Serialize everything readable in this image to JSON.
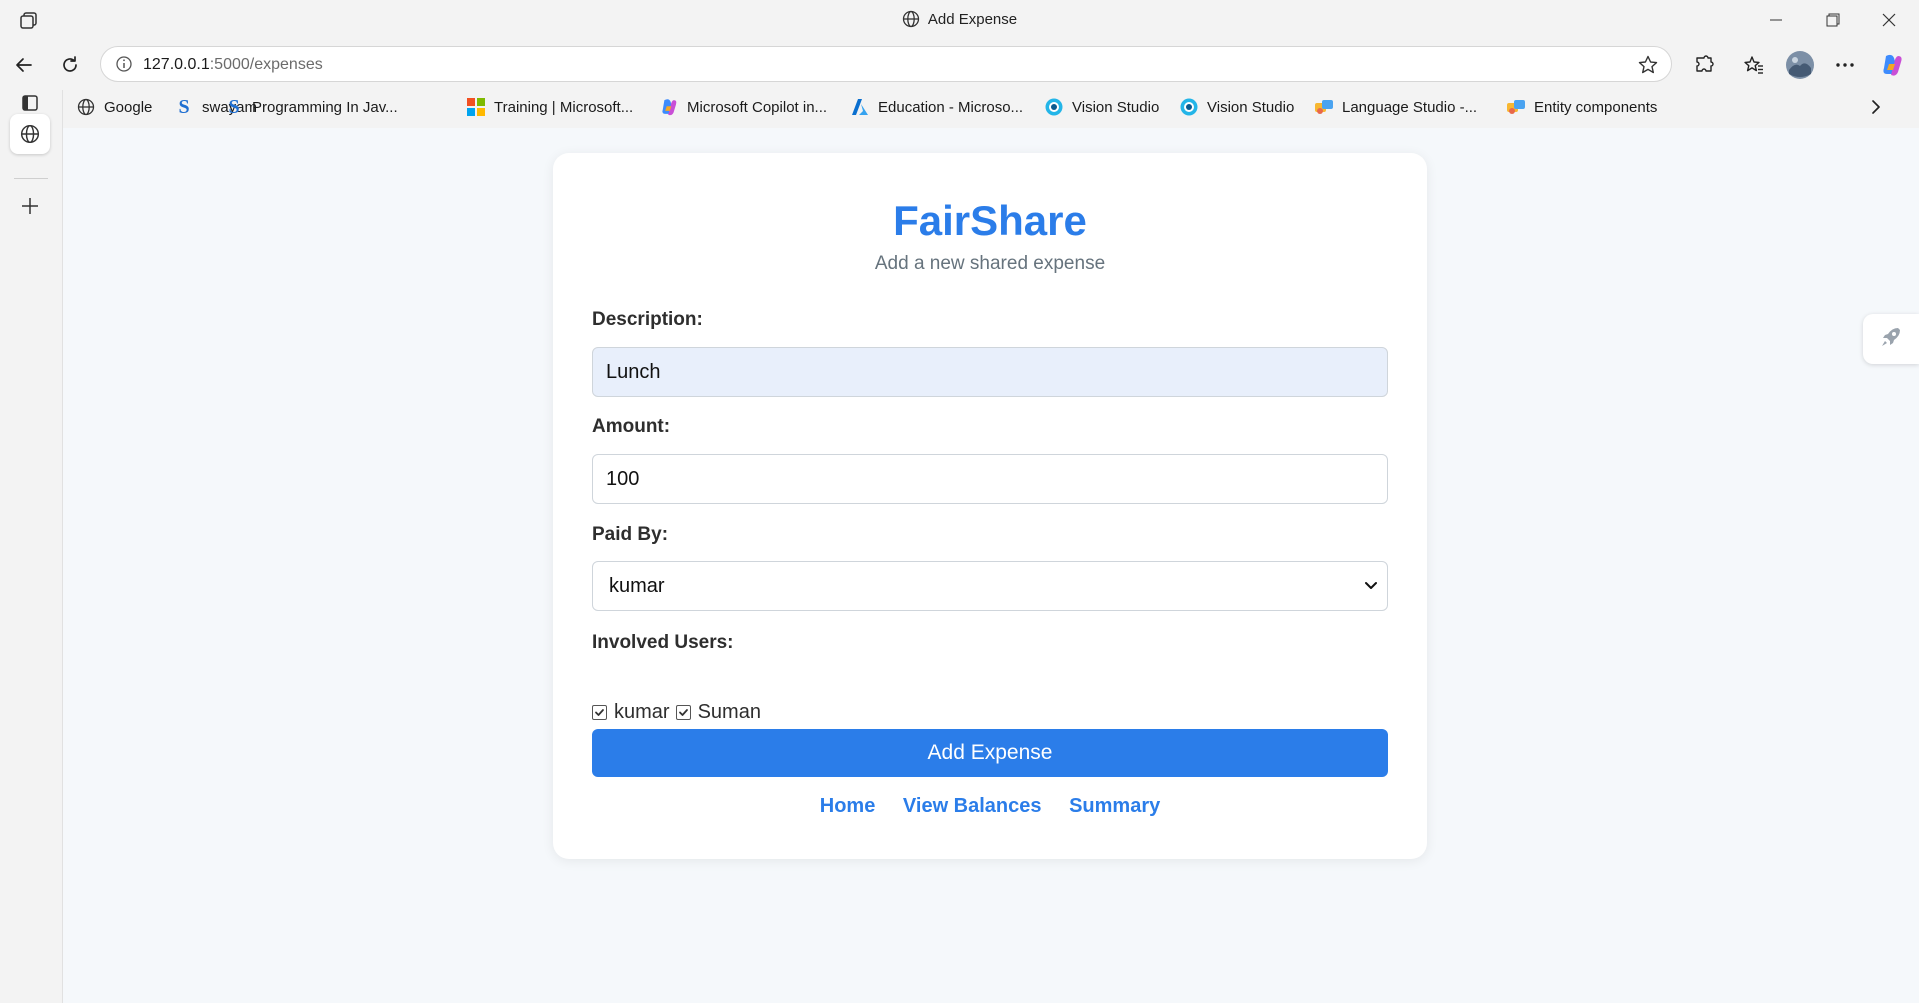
{
  "window": {
    "title": "Add Expense"
  },
  "address_bar": {
    "url_host": "127.0.0.1",
    "url_path": ":5000/expenses"
  },
  "bookmarks": [
    {
      "label": "Google",
      "icon": "globe-icon"
    },
    {
      "label": "swayam",
      "icon": "swayam-icon"
    },
    {
      "label": "Programming In Jav...",
      "icon": "swayam-icon"
    },
    {
      "label": "Training | Microsoft...",
      "icon": "microsoft-icon"
    },
    {
      "label": "Microsoft Copilot in...",
      "icon": "copilot-icon"
    },
    {
      "label": "Education - Microso...",
      "icon": "azure-icon"
    },
    {
      "label": "Vision Studio",
      "icon": "vision-studio-icon"
    },
    {
      "label": "Vision Studio",
      "icon": "vision-studio-icon"
    },
    {
      "label": "Language Studio -...",
      "icon": "language-studio-icon"
    },
    {
      "label": "Entity components",
      "icon": "language-studio-icon"
    }
  ],
  "page": {
    "brand": "FairShare",
    "subtitle": "Add a new shared expense",
    "description": {
      "label": "Description:",
      "value": "Lunch"
    },
    "amount": {
      "label": "Amount:",
      "value": "100"
    },
    "paid_by": {
      "label": "Paid By:",
      "value": "kumar"
    },
    "involved": {
      "label": "Involved Users:",
      "users": [
        {
          "name": "kumar",
          "checked": true
        },
        {
          "name": "Suman",
          "checked": true
        }
      ]
    },
    "submit_label": "Add Expense",
    "links": [
      "Home",
      "View Balances",
      "Summary"
    ]
  },
  "colors": {
    "accent": "#2b7de9",
    "autofill": "#e8effb",
    "page_bg": "#f5f8fb"
  }
}
